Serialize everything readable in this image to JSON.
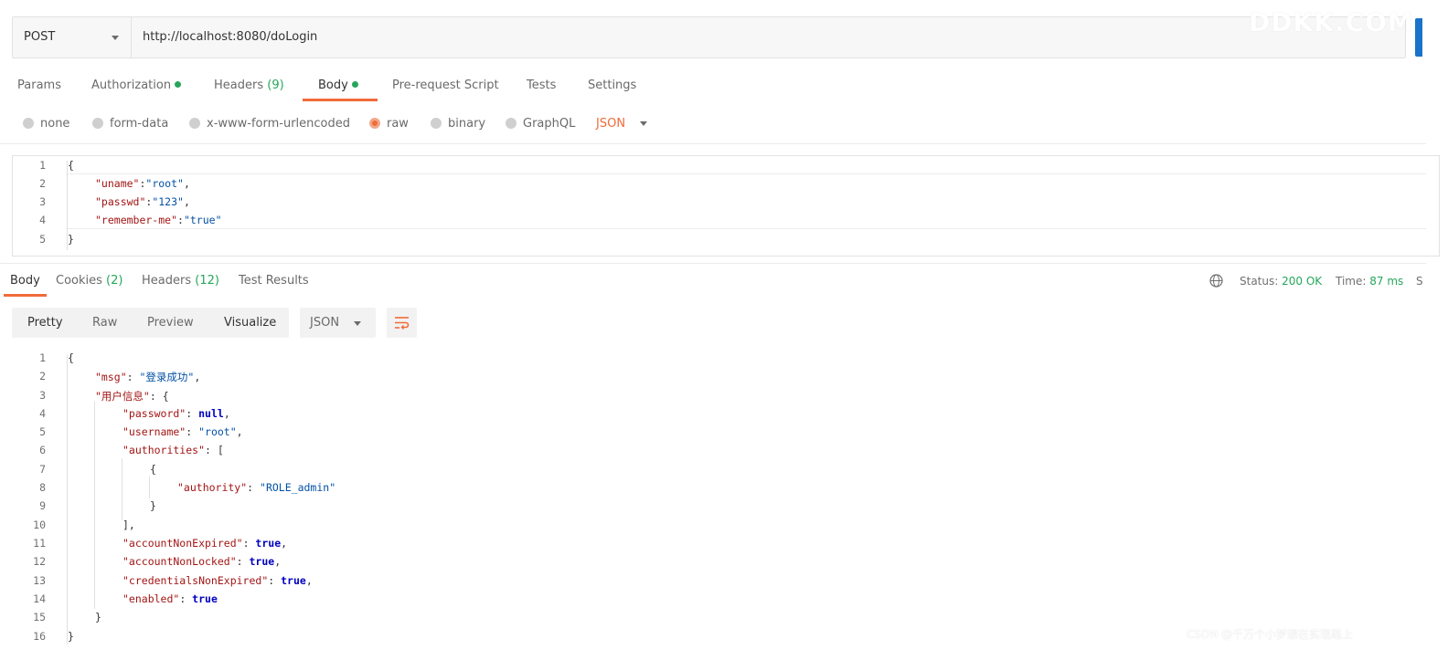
{
  "request": {
    "method": "POST",
    "url": "http://localhost:8080/doLogin",
    "watermark": "DDKK.COM"
  },
  "request_tabs": {
    "params": "Params",
    "authorization": "Authorization",
    "headers": "Headers",
    "headers_count": "(9)",
    "body": "Body",
    "pre_request": "Pre-request Script",
    "tests": "Tests",
    "settings": "Settings"
  },
  "body_types": {
    "none": "none",
    "form_data": "form-data",
    "urlencoded": "x-www-form-urlencoded",
    "raw": "raw",
    "binary": "binary",
    "graphql": "GraphQL",
    "mode": "JSON",
    "selected": "raw"
  },
  "request_body": {
    "lines": [
      {
        "n": "1",
        "brace": "{"
      },
      {
        "n": "2",
        "key": "\"uname\"",
        "sep": ":",
        "val": "\"root\"",
        "tail": ","
      },
      {
        "n": "3",
        "key": "\"passwd\"",
        "sep": ":",
        "val": "\"123\"",
        "tail": ","
      },
      {
        "n": "4",
        "key": "\"remember-me\"",
        "sep": ":",
        "val": "\"true\"",
        "tail": ""
      },
      {
        "n": "5",
        "brace": "}"
      }
    ]
  },
  "response_tabs": {
    "body": "Body",
    "cookies": "Cookies",
    "cookies_count": "(2)",
    "headers": "Headers",
    "headers_count": "(12)",
    "test_results": "Test Results"
  },
  "status": {
    "status_label": "Status:",
    "status_value": "200 OK",
    "time_label": "Time:",
    "time_value": "87 ms",
    "size_label": "S"
  },
  "response_toolbar": {
    "pretty": "Pretty",
    "raw": "Raw",
    "preview": "Preview",
    "visualize": "Visualize",
    "format": "JSON"
  },
  "response_body": {
    "l1": "{",
    "l2_key": "\"msg\"",
    "l2_val": "\"登录成功\"",
    "l3_key": "\"用户信息\"",
    "l3_open": "{",
    "l4_key": "\"password\"",
    "l4_val": "null",
    "l5_key": "\"username\"",
    "l5_val": "\"root\"",
    "l6_key": "\"authorities\"",
    "l6_open": "[",
    "l7": "{",
    "l8_key": "\"authority\"",
    "l8_val": "\"ROLE_admin\"",
    "l9": "}",
    "l10": "],",
    "l11_key": "\"accountNonExpired\"",
    "l11_val": "true",
    "l12_key": "\"accountNonLocked\"",
    "l12_val": "true",
    "l13_key": "\"credentialsNonExpired\"",
    "l13_val": "true",
    "l14_key": "\"enabled\"",
    "l14_val": "true",
    "l15": "}",
    "l16": "}"
  },
  "footer_watermark": "CSDN @千万个小梦想在实现路上",
  "colors": {
    "accent": "#f26b3a",
    "success": "#26a65b",
    "string": "#0451a5",
    "key": "#a31515"
  }
}
